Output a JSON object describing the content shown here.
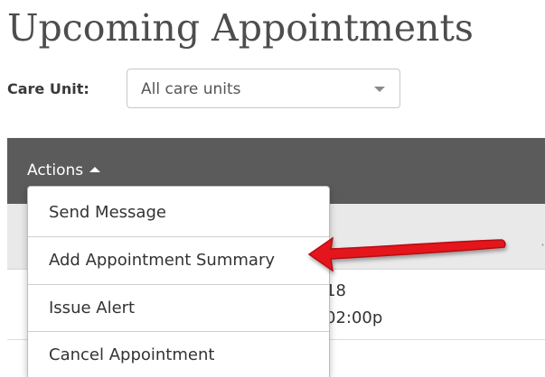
{
  "page": {
    "title": "Upcoming Appointments"
  },
  "filter": {
    "label": "Care Unit:",
    "selected": "All care units"
  },
  "table": {
    "actions_label": "Actions",
    "row": {
      "date_fragment": "18",
      "time_fragment": "02:00p"
    }
  },
  "actions_menu": {
    "items": [
      {
        "label": "Send Message"
      },
      {
        "label": "Add Appointment Summary"
      },
      {
        "label": "Issue Alert"
      },
      {
        "label": "Cancel Appointment"
      }
    ]
  },
  "colors": {
    "header_bg": "#5b5b5b",
    "annotation_arrow": "#e4161b"
  },
  "annotation": {
    "icon": "red-arrow-pointer-icon"
  }
}
